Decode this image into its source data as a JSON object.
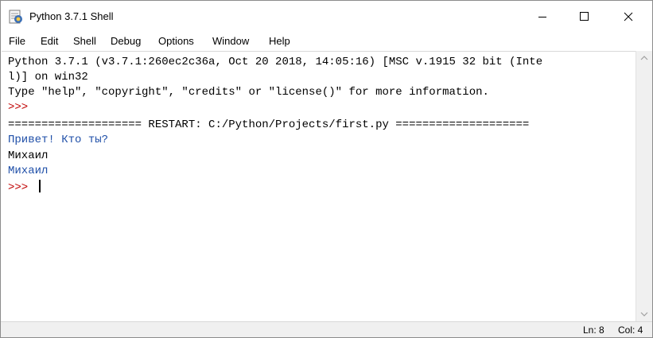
{
  "window": {
    "title": "Python 3.7.1 Shell",
    "icon": "idle-python-icon",
    "controls": [
      "minimize-icon",
      "maximize-icon",
      "close-icon"
    ]
  },
  "menu": {
    "items": [
      "File",
      "Edit",
      "Shell",
      "Debug",
      "Options",
      "Window",
      "Help"
    ]
  },
  "shell": {
    "lines": [
      "Python 3.7.1 (v3.7.1:260ec2c36a, Oct 20 2018, 14:05:16) [MSC v.1915 32 bit (Inte",
      "l)] on win32",
      "Type \"help\", \"copyright\", \"credits\" or \"license()\" for more information.",
      ">>> ",
      "==================== RESTART: C:/Python/Projects/first.py ====================",
      "Привет! Кто ты?",
      "Михаил",
      "Михаил",
      ">>> "
    ]
  },
  "status": {
    "line": "Ln: 8",
    "col": "Col: 4"
  },
  "colors": {
    "prompt": "#c00000",
    "program_output": "#1f4fa8",
    "user_input": "#000000"
  }
}
